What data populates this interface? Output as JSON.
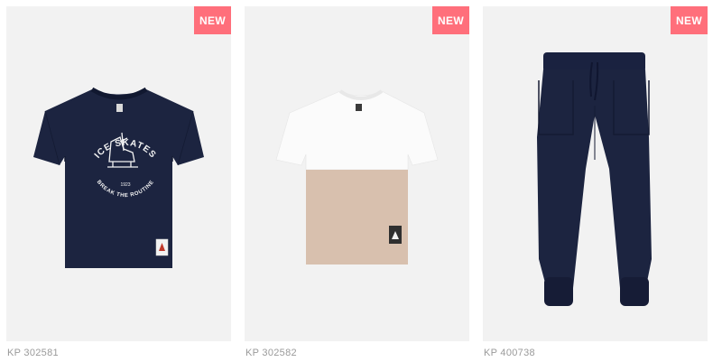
{
  "theme": {
    "badge_color": "#ff6f7b",
    "card_background": "#f2f2f2",
    "navy": "#1c2440",
    "beige": "#d8c0ae"
  },
  "products": [
    {
      "badge": "NEW",
      "print_text_top": "ICE SKATES",
      "print_text_year": "1923",
      "print_text_bottom": "BREAK THE ROUTINE",
      "sku": "KP 302581"
    },
    {
      "badge": "NEW",
      "sku": "KP 302582"
    },
    {
      "badge": "NEW",
      "sku": "KP 400738"
    }
  ]
}
